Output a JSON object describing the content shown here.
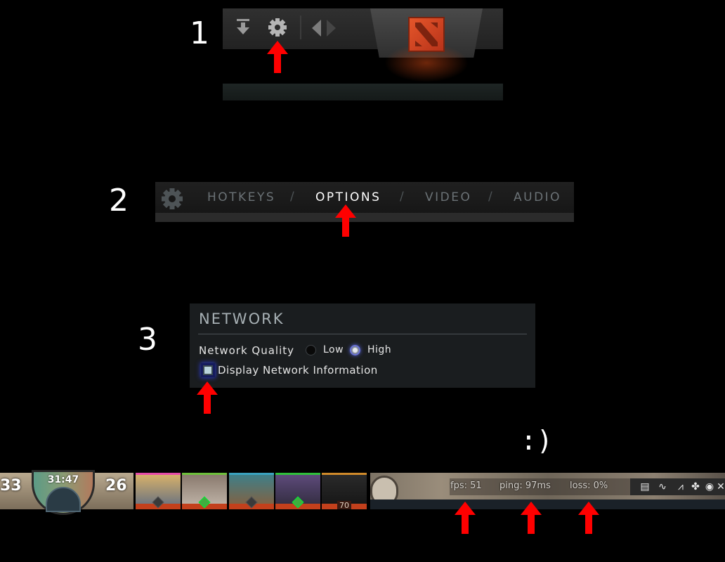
{
  "steps": {
    "one": "1",
    "two": "2",
    "three": "3"
  },
  "top_bar": {
    "icons": [
      "download-icon",
      "gear-icon",
      "left-right-arrows-icon",
      "dota-logo"
    ]
  },
  "settings_tabs": {
    "icon": "gear-icon",
    "tabs": [
      "HOTKEYS",
      "OPTIONS",
      "VIDEO",
      "AUDIO"
    ],
    "separator": "/",
    "active": "OPTIONS"
  },
  "network_panel": {
    "title": "NETWORK",
    "quality_label": "Network Quality",
    "options": [
      "Low",
      "High"
    ],
    "selected": "High",
    "display_info_label": "Display Network Information",
    "display_info_checked": true
  },
  "smiley": ":)",
  "hud": {
    "score_radiant": "33",
    "score_dire": "26",
    "clock": "31:47",
    "hero_level": "70",
    "fps": "fps: 51",
    "ping": "ping: 97ms",
    "loss": "loss: 0%",
    "icons": [
      "clipboard-icon",
      "xp-graph-icon",
      "gold-graph-icon",
      "paw-icon",
      "eye-icon",
      "close-icon"
    ]
  },
  "colors": {
    "arrow": "#ff0000",
    "accent_radio": "#6a73d8",
    "tab_inactive": "#6b7276",
    "tab_active": "#ffffff"
  }
}
